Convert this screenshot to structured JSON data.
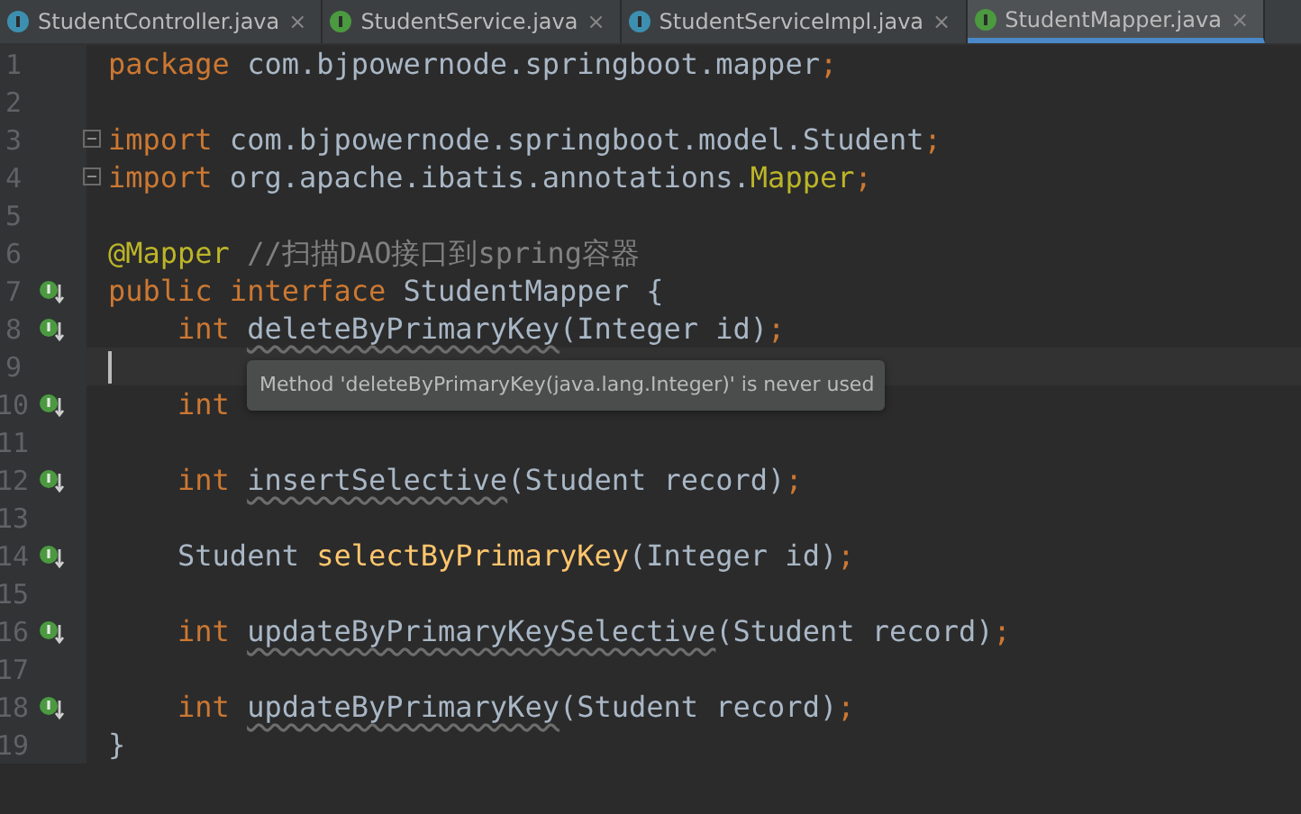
{
  "tabs": [
    {
      "label": "StudentController.java",
      "kind": "class",
      "close": "×",
      "selected": false
    },
    {
      "label": "StudentService.java",
      "kind": "interface",
      "close": "×",
      "selected": false
    },
    {
      "label": "StudentServiceImpl.java",
      "kind": "class",
      "close": "×",
      "selected": false
    },
    {
      "label": "StudentMapper.java",
      "kind": "interface",
      "close": "×",
      "selected": true
    }
  ],
  "editor": {
    "lines": [
      {
        "number": "1",
        "kind": "plain",
        "current": false,
        "tokens": [
          {
            "kind": "keyword",
            "text": "package"
          },
          {
            "kind": "plain",
            "text": " com.bjpowernode.springboot.mapper"
          },
          {
            "kind": "keyword",
            "text": ";"
          }
        ]
      },
      {
        "number": "2",
        "kind": "plain",
        "current": false
      },
      {
        "number": "3",
        "kind": "fold",
        "current": false,
        "tokens": [
          {
            "kind": "keyword",
            "text": "import"
          },
          {
            "kind": "plain",
            "text": " com.bjpowernode.springboot.model.Student"
          },
          {
            "kind": "keyword",
            "text": ";"
          }
        ]
      },
      {
        "number": "4",
        "kind": "fold",
        "current": false,
        "tokens": [
          {
            "kind": "keyword",
            "text": "import"
          },
          {
            "kind": "plain",
            "text": " org.apache.ibatis.annotations."
          },
          {
            "kind": "annotation",
            "text": "Mapper"
          },
          {
            "kind": "keyword",
            "text": ";"
          }
        ]
      },
      {
        "number": "5",
        "kind": "plain",
        "current": false
      },
      {
        "number": "6",
        "kind": "plain",
        "current": false,
        "tokens": [
          {
            "kind": "annotation",
            "text": "@Mapper"
          },
          {
            "kind": "comment",
            "text": " //扫描DAO接口到spring容器"
          }
        ]
      },
      {
        "number": "7",
        "kind": "override",
        "current": false,
        "tokens": [
          {
            "kind": "keyword",
            "text": "public interface"
          },
          {
            "kind": "plain",
            "text": " StudentMapper {"
          }
        ]
      },
      {
        "number": "8",
        "kind": "override",
        "current": false,
        "tokens": [
          {
            "kind": "keyword",
            "text": "    int "
          },
          {
            "kind": "unused",
            "text": "deleteByPrimaryKey"
          },
          {
            "kind": "plain",
            "text": "(Integer id)"
          },
          {
            "kind": "keyword",
            "text": ";"
          }
        ]
      },
      {
        "number": "9",
        "kind": "plain",
        "current": true
      },
      {
        "number": "10",
        "kind": "override",
        "current": false,
        "tokens": [
          {
            "kind": "keyword",
            "text": "    int"
          }
        ]
      },
      {
        "number": "11",
        "kind": "plain",
        "current": false
      },
      {
        "number": "12",
        "kind": "override",
        "current": false,
        "tokens": [
          {
            "kind": "keyword",
            "text": "    int "
          },
          {
            "kind": "unused",
            "text": "insertSelective"
          },
          {
            "kind": "plain",
            "text": "(Student record)"
          },
          {
            "kind": "keyword",
            "text": ";"
          }
        ]
      },
      {
        "number": "13",
        "kind": "plain",
        "current": false
      },
      {
        "number": "14",
        "kind": "override",
        "current": false,
        "tokens": [
          {
            "kind": "plain",
            "text": "    Student "
          },
          {
            "kind": "method",
            "text": "selectByPrimaryKey"
          },
          {
            "kind": "plain",
            "text": "(Integer id)"
          },
          {
            "kind": "keyword",
            "text": ";"
          }
        ]
      },
      {
        "number": "15",
        "kind": "plain",
        "current": false
      },
      {
        "number": "16",
        "kind": "override",
        "current": false,
        "tokens": [
          {
            "kind": "keyword",
            "text": "    int "
          },
          {
            "kind": "unused",
            "text": "updateByPrimaryKeySelective"
          },
          {
            "kind": "plain",
            "text": "(Student record)"
          },
          {
            "kind": "keyword",
            "text": ";"
          }
        ]
      },
      {
        "number": "17",
        "kind": "plain",
        "current": false
      },
      {
        "number": "18",
        "kind": "override",
        "current": false,
        "tokens": [
          {
            "kind": "keyword",
            "text": "    int "
          },
          {
            "kind": "unused",
            "text": "updateByPrimaryKey"
          },
          {
            "kind": "plain",
            "text": "(Student record)"
          },
          {
            "kind": "keyword",
            "text": ";"
          }
        ]
      },
      {
        "number": "19",
        "kind": "plain",
        "current": false,
        "tokens": [
          {
            "kind": "plain",
            "text": "}"
          }
        ]
      }
    ],
    "tooltip": {
      "text": "Method 'deleteByPrimaryKey(java.lang.Integer)' is never used"
    }
  }
}
